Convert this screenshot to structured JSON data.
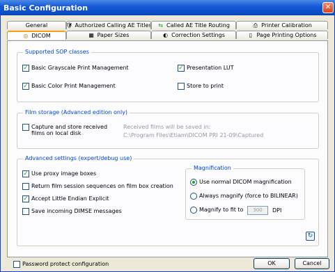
{
  "window": {
    "title": "Basic Configuration",
    "close_glyph": "✕"
  },
  "tabs": {
    "row1": [
      {
        "label": "General",
        "icon": ""
      },
      {
        "label": "Authorized Calling AE Titles",
        "icon": "ae-titles-icon"
      },
      {
        "label": "Called AE Title Routing",
        "icon": "routing-icon"
      },
      {
        "label": "Printer Calibration",
        "icon": "printer-calibration-icon"
      }
    ],
    "row2": [
      {
        "label": "DICOM",
        "icon": "dicom-icon",
        "active": true
      },
      {
        "label": "Paper Sizes",
        "icon": "paper-sizes-icon"
      },
      {
        "label": "Correction Settings",
        "icon": "correction-icon"
      },
      {
        "label": "Page Printing Options",
        "icon": "page-icon"
      }
    ]
  },
  "sop": {
    "title": "Supported SOP classes",
    "items": [
      {
        "label": "Basic Grayscale Print Management",
        "checked": true
      },
      {
        "label": "Presentation LUT",
        "checked": true
      },
      {
        "label": "Basic Color Print Management",
        "checked": true
      },
      {
        "label": "Store to print",
        "checked": false
      }
    ]
  },
  "film_storage": {
    "title": "Film storage (Advanced edition only)",
    "capture_label_line1": "Capture and store received",
    "capture_label_line2": "films on local disk",
    "saved_in_label": "Received films will be saved in:",
    "path": "C:\\Program Files\\Etiam\\DICOM PRI 21-09\\Captured"
  },
  "advanced": {
    "title": "Advanced settings (expert/debug use)",
    "items": [
      {
        "label": "Use proxy image boxes",
        "checked": true
      },
      {
        "label": "Return film session sequences on film box creation",
        "checked": false
      },
      {
        "label": "Accept Little Endian Explicit",
        "checked": true
      },
      {
        "label": "Save incoming DIMSE messages",
        "checked": false
      }
    ]
  },
  "magnification": {
    "title": "Magnification",
    "options": [
      {
        "label": "Use normal DICOM magnification",
        "selected": true
      },
      {
        "label": "Always magnify (force to BILINEAR)",
        "selected": false
      },
      {
        "label": "Magnify to fit to",
        "selected": false
      }
    ],
    "dpi_value": "300",
    "dpi_unit": "DPI"
  },
  "footer": {
    "password_label": "Password protect configuration",
    "ok_label": "OK",
    "cancel_label": "Cancel"
  },
  "colors": {
    "group_title": "#0046d5",
    "check": "#21a121",
    "active_tab_accent": "#f2a316",
    "titlebar": "#1557d6"
  }
}
